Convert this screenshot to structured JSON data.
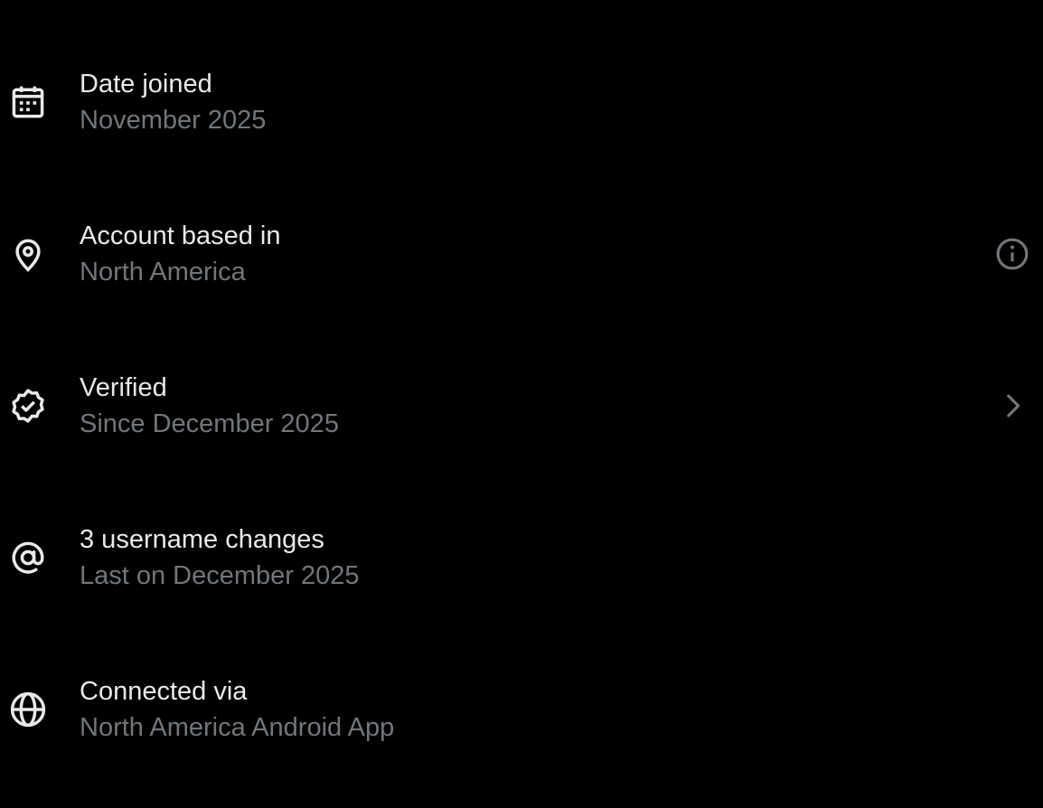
{
  "colors": {
    "background": "#000000",
    "primary_text": "#e7e9ea",
    "secondary_text": "#71767b",
    "icon": "#e7e9ea",
    "trailing_icon": "#71767b"
  },
  "rows": [
    {
      "icon": "calendar-icon",
      "title": "Date joined",
      "subtitle": "November 2025"
    },
    {
      "icon": "location-pin-icon",
      "title": "Account based in",
      "subtitle": "North America",
      "trailing_icon": "info-icon"
    },
    {
      "icon": "verified-badge-icon",
      "title": "Verified",
      "subtitle": "Since December 2025",
      "trailing_icon": "chevron-right-icon"
    },
    {
      "icon": "at-sign-icon",
      "title": "3 username changes",
      "subtitle": "Last on December 2025"
    },
    {
      "icon": "globe-icon",
      "title": "Connected via",
      "subtitle": "North America Android App"
    }
  ]
}
